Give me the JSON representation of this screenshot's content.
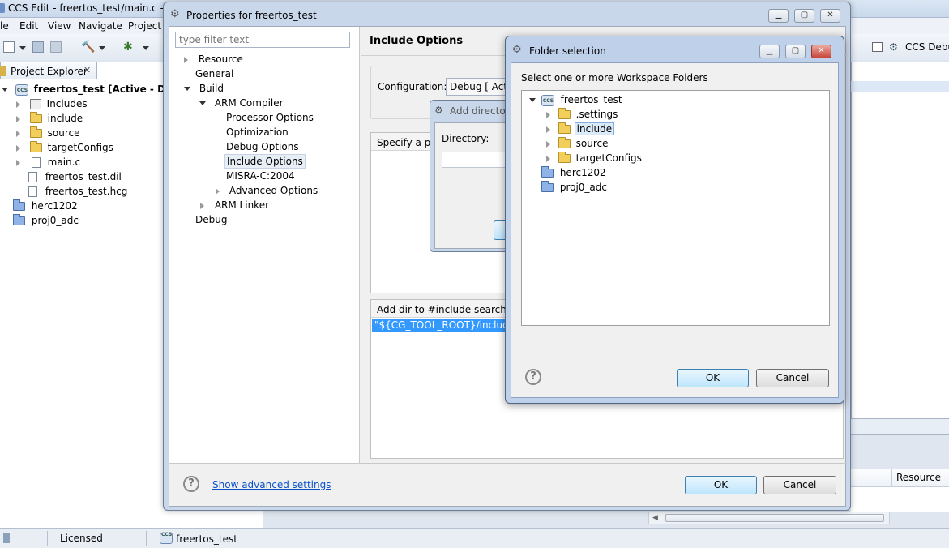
{
  "main_window": {
    "title": "CCS Edit - freertos_test/main.c - Co",
    "menu": [
      "le",
      "Edit",
      "View",
      "Navigate",
      "Project"
    ],
    "right_perspective": "CCS Debu",
    "project_explorer": {
      "tab_label": "Project Explorer",
      "items": [
        {
          "label": "freertos_test  [Active - Debug",
          "bold": true
        },
        {
          "label": "Includes"
        },
        {
          "label": "include"
        },
        {
          "label": "source"
        },
        {
          "label": "targetConfigs"
        },
        {
          "label": "main.c"
        },
        {
          "label": "freertos_test.dil"
        },
        {
          "label": "freertos_test.hcg"
        },
        {
          "label": "herc1202"
        },
        {
          "label": "proj0_adc"
        }
      ]
    },
    "problems_column": "Resource",
    "status_bar": {
      "license": "Licensed",
      "project": "freertos_test"
    }
  },
  "properties_dialog": {
    "title": "Properties for freertos_test",
    "filter_placeholder": "type filter text",
    "tree": [
      "Resource",
      "General",
      "Build",
      "ARM Compiler",
      "Processor Options",
      "Optimization",
      "Debug Options",
      "Include Options",
      "MISRA-C:2004",
      "Advanced Options",
      "ARM Linker",
      "Debug"
    ],
    "page_title": "Include Options",
    "configuration_label": "Configuration:",
    "configuration_value": "Debug  [ Activ",
    "specify_label": "Specify a pre",
    "add_dir_label": "Add dir to #include search pat",
    "include_entry": "\"${CG_TOOL_ROOT}/include\"",
    "advanced_link": "Show advanced settings",
    "ok": "OK",
    "cancel": "Cancel",
    "help": "?"
  },
  "add_directory_dialog": {
    "title": "Add directory",
    "directory_label": "Directory:"
  },
  "folder_dialog": {
    "title": "Folder selection",
    "instruction": "Select one or more Workspace Folders",
    "tree": [
      "freertos_test",
      ".settings",
      "include",
      "source",
      "targetConfigs",
      "herc1202",
      "proj0_adc"
    ],
    "ok": "OK",
    "cancel": "Cancel",
    "help": "?"
  }
}
